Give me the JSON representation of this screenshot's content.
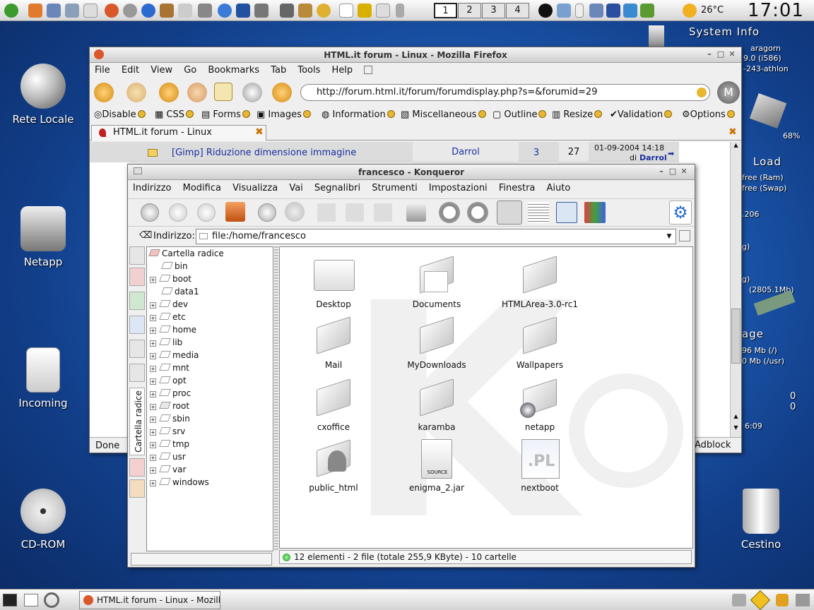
{
  "topbar": {
    "desktops": [
      "1",
      "2",
      "3",
      "4"
    ],
    "weather_temp": "26°C",
    "clock": "17:01"
  },
  "desktop_icons": {
    "rete": "Rete Locale",
    "netapp": "Netapp",
    "incoming": "Incoming",
    "cdrom": "CD-ROM",
    "cestino": "Cestino"
  },
  "sysinfo": {
    "title": "System Info",
    "host": "aragorn",
    "kernel": "9.0 (i586)",
    "arch": "-243-athlon",
    "pct": "68%",
    "load": "Load",
    "ram": "free (Ram)",
    "swap": "free (Swap)",
    "ip": ".206",
    "g1": "g)",
    "g2": "g)",
    "net": "(2805.1Mb)",
    "usage": "age",
    "disk1": "96 Mb (/)",
    "disk2": "0 Mb (/usr)",
    "zero1": "0",
    "zero2": "0",
    "uptime": "6:09"
  },
  "firefox": {
    "title": "HTML.it forum - Linux - Mozilla Firefox",
    "menu": [
      "File",
      "Edit",
      "View",
      "Go",
      "Bookmarks",
      "Tab",
      "Tools",
      "Help"
    ],
    "url": "http://forum.html.it/forum/forumdisplay.php?s=&forumid=29",
    "devbar": [
      "Disable",
      "CSS",
      "Forms",
      "Images",
      "Information",
      "Miscellaneous",
      "Outline",
      "Resize",
      "Validation",
      "Options"
    ],
    "tab": "HTML.it forum - Linux",
    "row": {
      "topic": "[Gimp] Riduzione dimensione immagine",
      "author": "Darrol",
      "replies": "3",
      "views": "27",
      "date": "01-09-2004 14:18",
      "by": "di",
      "last": "Darrol"
    },
    "status": "Done",
    "adblock": "Adblock"
  },
  "konqueror": {
    "title": "francesco - Konqueror",
    "menu": [
      "Indirizzo",
      "Modifica",
      "Visualizza",
      "Vai",
      "Segnalibri",
      "Strumenti",
      "Impostazioni",
      "Finestra",
      "Aiuto"
    ],
    "address_label": "Indirizzo:",
    "address": "file:/home/francesco",
    "sidebar_tab": "Cartella radice",
    "tree_root": "Cartella radice",
    "tree": [
      "bin",
      "boot",
      "data1",
      "dev",
      "etc",
      "home",
      "lib",
      "media",
      "mnt",
      "opt",
      "proc",
      "root",
      "sbin",
      "srv",
      "tmp",
      "usr",
      "var",
      "windows"
    ],
    "files": [
      "Desktop",
      "Documents",
      "HTMLArea-3.0-rc1",
      "Mail",
      "MyDownloads",
      "Wallpapers",
      "cxoffice",
      "karamba",
      "netapp",
      "public_html",
      "enigma_2.jar",
      "nextboot"
    ],
    "jar_caption": "SOURCE",
    "pl_caption": ".PL",
    "status": "12 elementi - 2 file (totale 255,9 KByte) - 10 cartelle"
  },
  "taskbar": {
    "task": "HTML.it forum - Linux - Mozill"
  },
  "colors": {
    "accent": "#1f5fb8",
    "link": "#1a2fa0"
  }
}
